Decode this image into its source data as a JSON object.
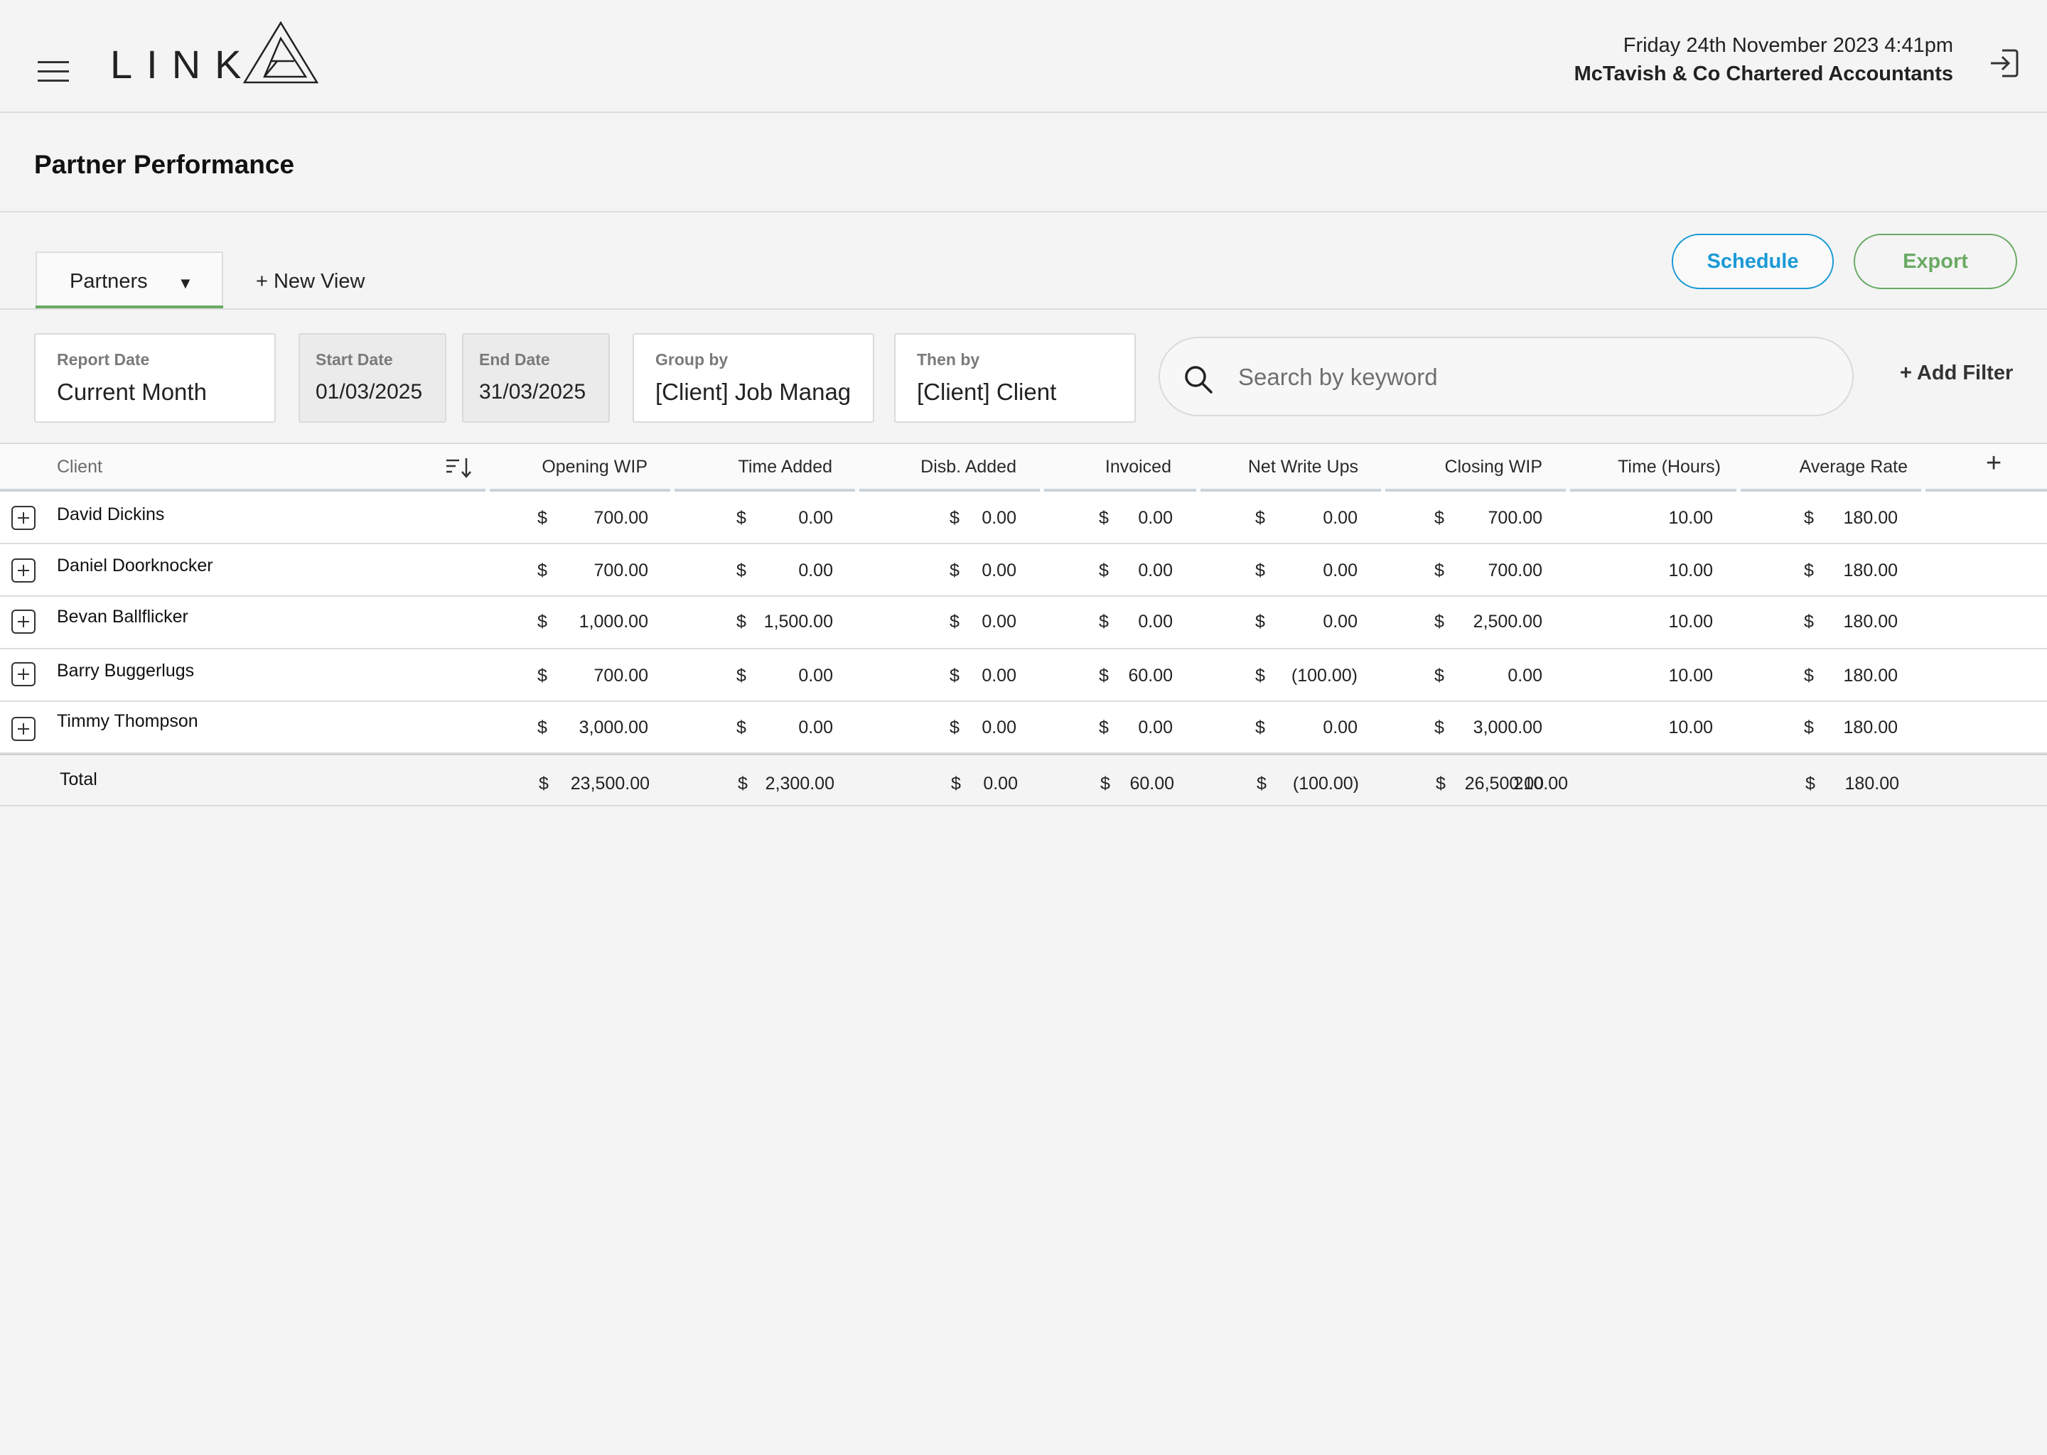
{
  "header": {
    "app_name": "LINK",
    "datetime": "Friday 24th November 2023  4:41pm",
    "firm": "McTavish & Co Chartered Accountants"
  },
  "page": {
    "title": "Partner Performance"
  },
  "views": {
    "active_tab": "Partners",
    "new_view_label": "+ New View"
  },
  "actions": {
    "schedule": "Schedule",
    "export": "Export"
  },
  "filters": {
    "report_date": {
      "label": "Report Date",
      "value": "Current Month"
    },
    "start_date": {
      "label": "Start Date",
      "value": "01/03/2025"
    },
    "end_date": {
      "label": "End Date",
      "value": "31/03/2025"
    },
    "group_by": {
      "label": "Group by",
      "value": "[Client] Job Manag"
    },
    "then_by": {
      "label": "Then by",
      "value": "[Client] Client"
    },
    "search_placeholder": "Search by keyword",
    "add_filter": "+ Add Filter"
  },
  "table": {
    "columns": [
      "Client",
      "Opening WIP",
      "Time Added",
      "Disb. Added",
      "Invoiced",
      "Net Write Ups",
      "Closing WIP",
      "Time (Hours)",
      "Average Rate"
    ],
    "currency": "$",
    "rows": [
      {
        "client": "David Dickins",
        "opening_wip": "700.00",
        "time_added": "0.00",
        "disb_added": "0.00",
        "invoiced": "0.00",
        "net_write_ups": "0.00",
        "closing_wip": "700.00",
        "hours": "10.00",
        "avg_rate": "180.00"
      },
      {
        "client": "Daniel Doorknocker",
        "opening_wip": "700.00",
        "time_added": "0.00",
        "disb_added": "0.00",
        "invoiced": "0.00",
        "net_write_ups": "0.00",
        "closing_wip": "700.00",
        "hours": "10.00",
        "avg_rate": "180.00"
      },
      {
        "client": "Bevan Ballflicker",
        "opening_wip": "1,000.00",
        "time_added": "1,500.00",
        "disb_added": "0.00",
        "invoiced": "0.00",
        "net_write_ups": "0.00",
        "closing_wip": "2,500.00",
        "hours": "10.00",
        "avg_rate": "180.00"
      },
      {
        "client": "Barry Buggerlugs",
        "opening_wip": "700.00",
        "time_added": "0.00",
        "disb_added": "0.00",
        "invoiced": "60.00",
        "net_write_ups": "(100.00)",
        "closing_wip": "0.00",
        "hours": "10.00",
        "avg_rate": "180.00"
      },
      {
        "client": "Timmy Thompson",
        "opening_wip": "3,000.00",
        "time_added": "0.00",
        "disb_added": "0.00",
        "invoiced": "0.00",
        "net_write_ups": "0.00",
        "closing_wip": "3,000.00",
        "hours": "10.00",
        "avg_rate": "180.00"
      }
    ],
    "total": {
      "label": "Total",
      "opening_wip": "23,500.00",
      "time_added": "2,300.00",
      "disb_added": "0.00",
      "invoiced": "60.00",
      "net_write_ups": "(100.00)",
      "closing_wip": "26,500.00",
      "hours": "210.00",
      "avg_rate": "180.00"
    }
  }
}
